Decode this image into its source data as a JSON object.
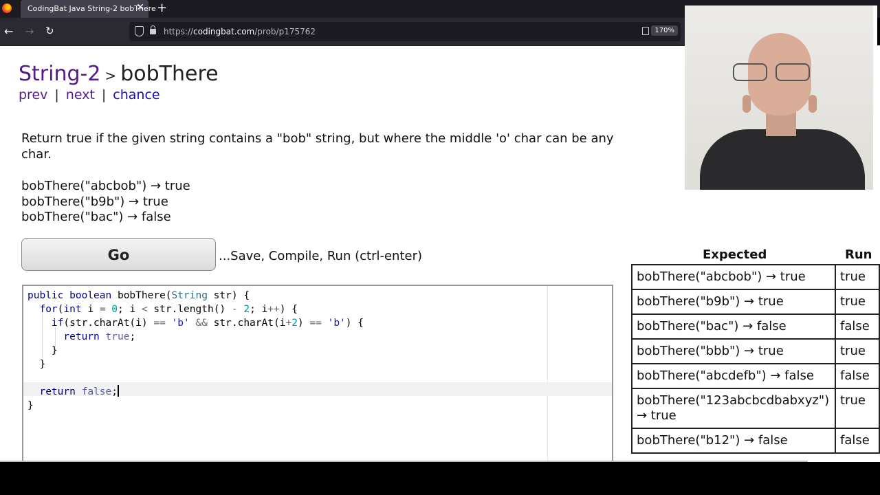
{
  "browser": {
    "tab_title": "CodingBat Java String-2 bobThere",
    "tab_close": "✕",
    "new_tab": "+",
    "url_prefix": "https://",
    "url_domain": "codingbat.com",
    "url_path": "/prob/p175762",
    "zoom": "170%"
  },
  "page": {
    "section": "String-2",
    "separator": ">",
    "problem": "bobThere",
    "nav": {
      "prev": "prev",
      "next": "next",
      "chance": "chance",
      "sep": "|"
    },
    "description": "Return true if the given string contains a \"bob\" string, but where the middle 'o' char can be any char.",
    "examples": [
      "bobThere(\"abcbob\") → true",
      "bobThere(\"b9b\") → true",
      "bobThere(\"bac\") → false"
    ],
    "go_label": "Go",
    "go_hint": "...Save, Compile, Run (ctrl-enter)"
  },
  "results": {
    "header_expected": "Expected",
    "header_run": "Run",
    "rows": [
      {
        "expected": "bobThere(\"abcbob\") → true",
        "run": "true"
      },
      {
        "expected": "bobThere(\"b9b\") → true",
        "run": "true"
      },
      {
        "expected": "bobThere(\"bac\") → false",
        "run": "false"
      },
      {
        "expected": "bobThere(\"bbb\") → true",
        "run": "true"
      },
      {
        "expected": "bobThere(\"abcdefb\") → false",
        "run": "false"
      },
      {
        "expected": "bobThere(\"123abcbcdbabxyz\") → true",
        "run": "true"
      },
      {
        "expected": "bobThere(\"b12\") → false",
        "run": "false"
      }
    ]
  },
  "colors": {
    "visited_link": "#551a8b",
    "link": "#1a0dab",
    "chrome_dark": "#1c1b22",
    "chrome_mid": "#2b2a33"
  },
  "icons": [
    "firefox-icon",
    "back-icon",
    "forward-icon",
    "reload-icon",
    "shield-icon",
    "lock-icon",
    "reader-view-icon"
  ]
}
